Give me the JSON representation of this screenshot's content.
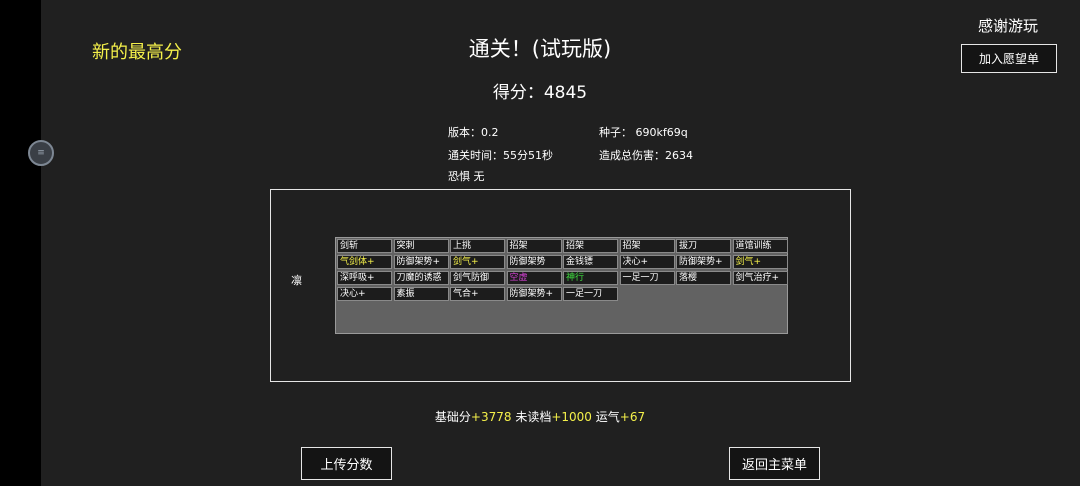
{
  "header": {
    "new_record": "新的最高分",
    "title": "通关！(试玩版)",
    "score": "得分：4845",
    "thanks": "感谢游玩",
    "wishlist_button": "加入愿望单"
  },
  "stats": {
    "version": "版本：0.2",
    "seed": "种子：  690kf69q",
    "clear_time": "通关时间：55分51秒",
    "total_damage": "造成总伤害：2634",
    "fear": "恐惧  无"
  },
  "character": {
    "name": "凛"
  },
  "cards": [
    {
      "label": "剑斩",
      "color": "#ffffff"
    },
    {
      "label": "突刺",
      "color": "#ffffff"
    },
    {
      "label": "上挑",
      "color": "#ffffff"
    },
    {
      "label": "招架",
      "color": "#ffffff"
    },
    {
      "label": "招架",
      "color": "#ffffff"
    },
    {
      "label": "招架",
      "color": "#ffffff"
    },
    {
      "label": "拔刀",
      "color": "#ffffff"
    },
    {
      "label": "道馆训练",
      "color": "#ffffff"
    },
    {
      "label": "气剑体+",
      "color": "#f4f04a"
    },
    {
      "label": "防御架势+",
      "color": "#ffffff"
    },
    {
      "label": "剑气+",
      "color": "#f4f04a"
    },
    {
      "label": "防御架势",
      "color": "#ffffff"
    },
    {
      "label": "金钱镖",
      "color": "#ffffff"
    },
    {
      "label": "决心+",
      "color": "#ffffff"
    },
    {
      "label": "防御架势+",
      "color": "#ffffff"
    },
    {
      "label": "剑气+",
      "color": "#f4f04a"
    },
    {
      "label": "深呼吸+",
      "color": "#ffffff"
    },
    {
      "label": "刀魔的诱惑",
      "color": "#ffffff"
    },
    {
      "label": "剑气防御",
      "color": "#ffffff"
    },
    {
      "label": "空虚",
      "color": "#d040d0"
    },
    {
      "label": "神行",
      "color": "#40e040"
    },
    {
      "label": "一足一刀",
      "color": "#ffffff"
    },
    {
      "label": "落樱",
      "color": "#ffffff"
    },
    {
      "label": "剑气治疗+",
      "color": "#ffffff"
    },
    {
      "label": "决心+",
      "color": "#ffffff"
    },
    {
      "label": "素振",
      "color": "#ffffff"
    },
    {
      "label": "气合+",
      "color": "#ffffff"
    },
    {
      "label": "防御架势+",
      "color": "#ffffff"
    },
    {
      "label": "一足一刀",
      "color": "#ffffff"
    }
  ],
  "summary": {
    "base_label": "基础分",
    "base_value": "+3778",
    "unread_label": " 未读档",
    "unread_value": "+1000",
    "luck_label": " 运气",
    "luck_value": "+67"
  },
  "buttons": {
    "upload": "上传分数",
    "main_menu": "返回主菜单"
  },
  "colors": {
    "accent_yellow": "#f4f04a",
    "background": "#202020",
    "card_area": "#626262"
  }
}
